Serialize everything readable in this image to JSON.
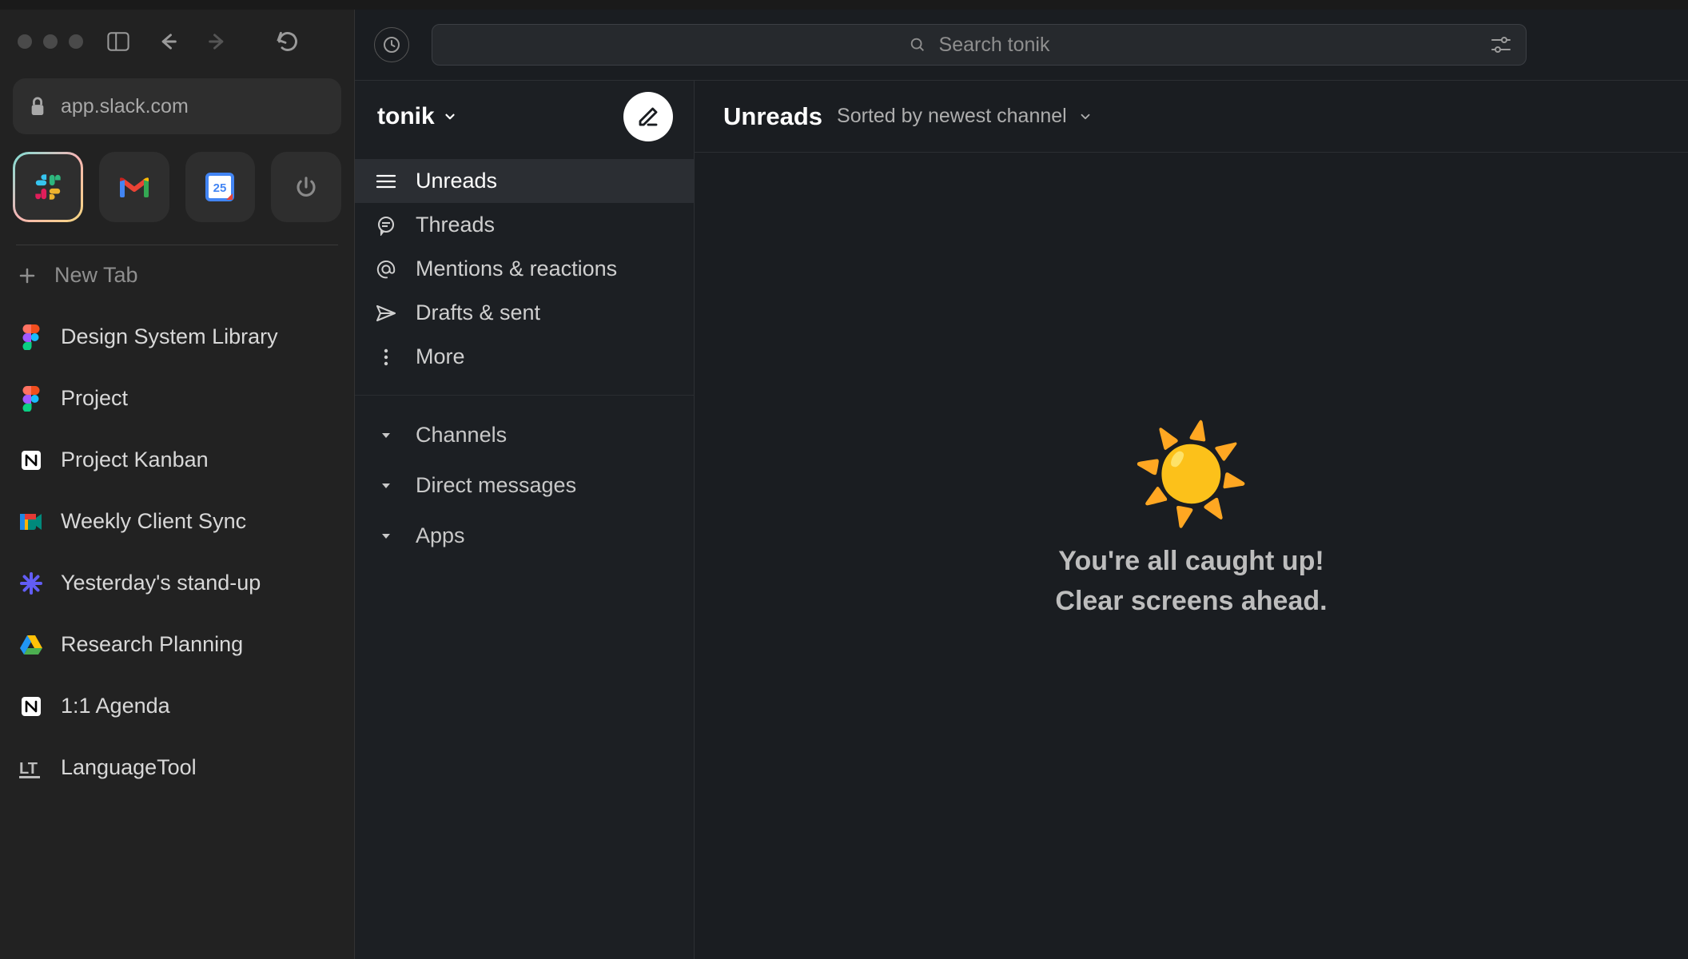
{
  "browser": {
    "url": "app.slack.com",
    "new_tab_label": "New Tab",
    "tabs": [
      {
        "label": "Design System Library",
        "icon": "figma"
      },
      {
        "label": "Project",
        "icon": "figma"
      },
      {
        "label": "Project Kanban",
        "icon": "notion"
      },
      {
        "label": "Weekly Client Sync",
        "icon": "meet"
      },
      {
        "label": "Yesterday's stand-up",
        "icon": "loom"
      },
      {
        "label": "Research Planning",
        "icon": "drive"
      },
      {
        "label": "1:1 Agenda",
        "icon": "notion"
      },
      {
        "label": "LanguageTool",
        "icon": "lt"
      }
    ]
  },
  "slack": {
    "search_placeholder": "Search tonik",
    "workspace_name": "tonik",
    "nav": [
      {
        "label": "Unreads",
        "icon": "unreads",
        "active": true
      },
      {
        "label": "Threads",
        "icon": "threads"
      },
      {
        "label": "Mentions & reactions",
        "icon": "mentions"
      },
      {
        "label": "Drafts & sent",
        "icon": "drafts"
      },
      {
        "label": "More",
        "icon": "more"
      }
    ],
    "sections": [
      {
        "label": "Channels"
      },
      {
        "label": "Direct messages"
      },
      {
        "label": "Apps"
      }
    ],
    "content": {
      "title": "Unreads",
      "sort_label": "Sorted by newest channel",
      "empty_emoji": "☀️",
      "empty_line1": "You're all caught up!",
      "empty_line2": "Clear screens ahead."
    }
  }
}
